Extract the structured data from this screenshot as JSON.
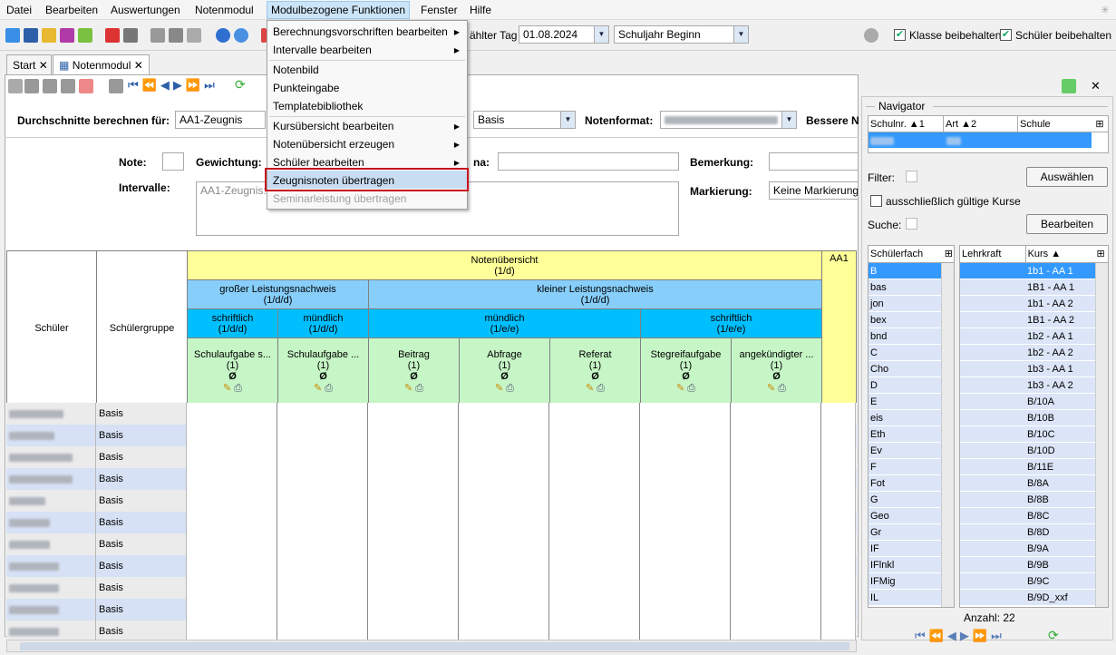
{
  "menu": {
    "items": [
      "Datei",
      "Bearbeiten",
      "Auswertungen",
      "Notenmodul",
      "Modulbezogene Funktionen",
      "Fenster",
      "Hilfe"
    ]
  },
  "toolbar": {
    "date_label": "ählter Tag",
    "date_value": "01.08.2024",
    "period_value": "Schuljahr Beginn",
    "keep_class": "Klasse beibehalten",
    "keep_student": "Schüler beibehalten"
  },
  "tabs": {
    "start": "Start",
    "notenmodul": "Notenmodul"
  },
  "dropdown": {
    "items": [
      "Berechnungsvorschriften bearbeiten",
      "Intervalle bearbeiten",
      "Notenbild",
      "Punkteingabe",
      "Templatebibliothek",
      "Kursübersicht bearbeiten",
      "Notenübersicht erzeugen",
      "Schüler bearbeiten",
      "Zeugnisnoten übertragen",
      "Seminarleistung übertragen"
    ]
  },
  "form": {
    "avg_label": "Durchschnitte berechnen für:",
    "avg_value": "AA1-Zeugnis",
    "basis_value": "Basis",
    "format_label": "Notenformat:",
    "better_label": "Bessere N",
    "note_label": "Note:",
    "weight_label": "Gewichtung:",
    "theme_label": "na:",
    "remark_label": "Bemerkung:",
    "interval_label": "Intervalle:",
    "interval_value": "AA1-Zeugnis:",
    "marking_label": "Markierung:",
    "marking_value": "Keine Markierung"
  },
  "grid": {
    "col_student": "Schüler",
    "col_group": "Schülergruppe",
    "overview": "Notenübersicht",
    "overview_sub": "(1/d)",
    "aa1": "AA1",
    "gross": "großer Leistungsnachweis",
    "gross_sub": "(1/d/d)",
    "klein": "kleiner Leistungsnachweis",
    "klein_sub": "(1/d/d)",
    "schriftlich": "schriftlich",
    "schriftlich_sub": "(1/d/d)",
    "muendlich": "mündlich",
    "muendlich_sub": "(1/d/d)",
    "muendlich2": "mündlich",
    "muendlich2_sub": "(1/e/e)",
    "schriftlich2": "schriftlich",
    "schriftlich2_sub": "(1/e/e)",
    "cols": [
      "Schulaufgabe s...",
      "Schulaufgabe ...",
      "Beitrag",
      "Abfrage",
      "Referat",
      "Stegreifaufgabe",
      "angekündigter ..."
    ],
    "col_sub": "(1)",
    "avg_symbol": "Ø",
    "rows": [
      "Basis",
      "Basis",
      "Basis",
      "Basis",
      "Basis",
      "Basis",
      "Basis",
      "Basis",
      "Basis",
      "Basis",
      "Basis"
    ]
  },
  "navigator": {
    "title": "Navigator",
    "h_schulnr": "Schulnr.",
    "h_art": "Art",
    "h_schule": "Schule",
    "filter_label": "Filter:",
    "select_btn": "Auswählen",
    "only_valid": "ausschließlich gültige Kurse",
    "search_label": "Suche:",
    "edit_btn": "Bearbeiten",
    "h_fach": "Schülerfach",
    "h_lehrkraft": "Lehrkraft",
    "h_kurs": "Kurs",
    "faecher": [
      "B",
      "bas",
      "jon",
      "bex",
      "bnd",
      "C",
      "Cho",
      "D",
      "E",
      "eis",
      "Eth",
      "Ev",
      "F",
      "Fot",
      "G",
      "Geo",
      "Gr",
      "IF",
      "IFlnkl",
      "IFMig",
      "IL"
    ],
    "kurse": [
      "1b1 - AA 1",
      "1B1 - AA 1",
      "1b1 - AA 2",
      "1B1 - AA 2",
      "1b2 - AA 1",
      "1b2 - AA 2",
      "1b3 - AA 1",
      "1b3 - AA 2",
      "B/10A",
      "B/10B",
      "B/10C",
      "B/10D",
      "B/11E",
      "B/8A",
      "B/8B",
      "B/8C",
      "B/8D",
      "B/9A",
      "B/9B",
      "B/9C",
      "B/9D_xxf"
    ],
    "count": "Anzahl: 22"
  }
}
